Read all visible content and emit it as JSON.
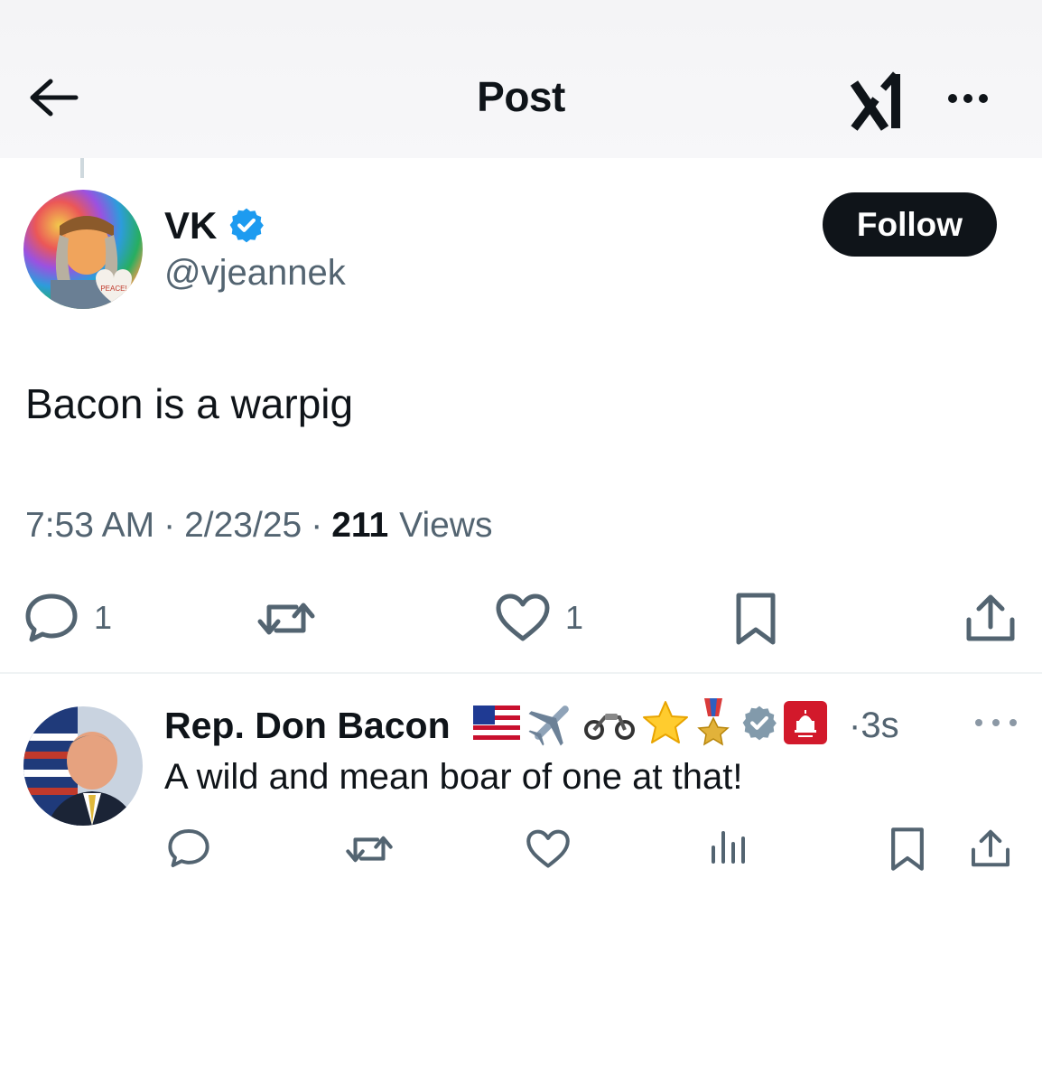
{
  "header": {
    "title": "Post",
    "back_icon": "arrow-left-icon",
    "grok_icon": "grok-icon",
    "more_icon": "more-horizontal-icon"
  },
  "post": {
    "author": {
      "name": "VK",
      "handle": "@vjeannek",
      "verified": true,
      "avatar_label": "PEACE!"
    },
    "follow_label": "Follow",
    "text": "Bacon is a warpig",
    "time": "7:53 AM",
    "date": "2/23/25",
    "separator": "·",
    "views_count": "211",
    "views_label": "Views",
    "actions": {
      "reply_count": "1",
      "like_count": "1"
    }
  },
  "reply": {
    "author_name": "Rep. Don Bacon",
    "emojis": [
      "us-flag-icon",
      "airplane-icon",
      "motorcycle-icon",
      "star-icon",
      "military-medal-icon"
    ],
    "verified_type": "government",
    "affiliate_badge": "House GOP",
    "time": "·3s",
    "text": "A wild and mean boar of one at that!"
  },
  "colors": {
    "text_primary": "#0f1419",
    "text_secondary": "#536471",
    "verified_blue": "#1d9bf0",
    "verified_gray": "#829aab",
    "header_bg": "#f5f5f7"
  }
}
